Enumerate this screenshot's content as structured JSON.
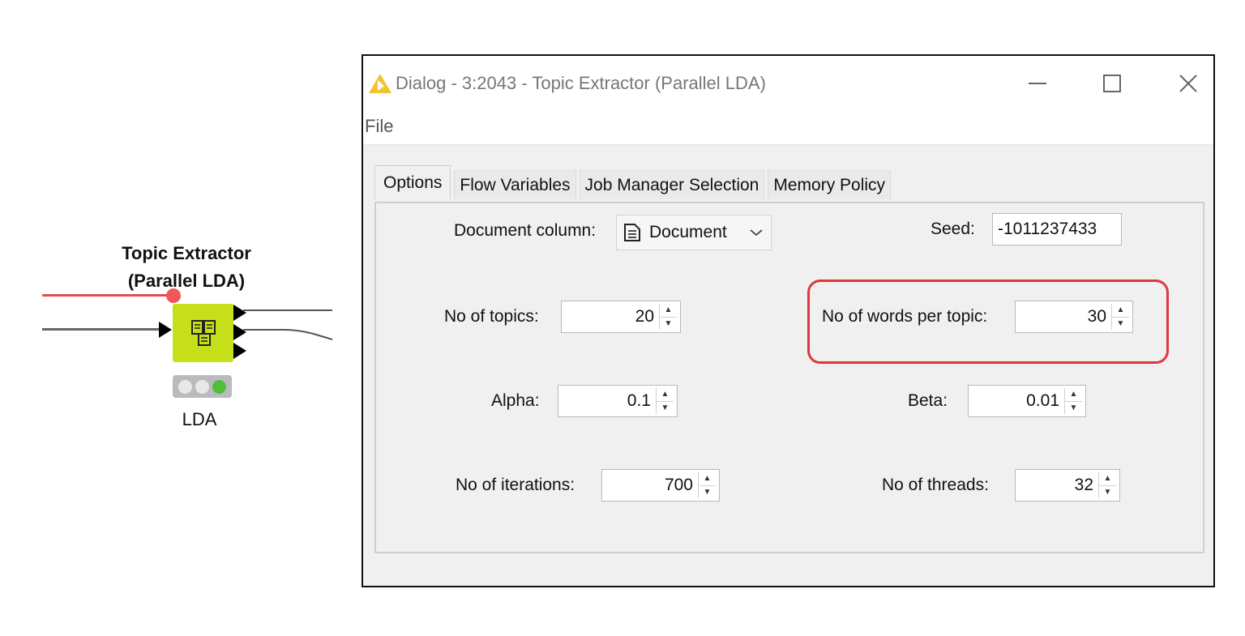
{
  "node": {
    "title_line1": "Topic Extractor",
    "title_line2": "(Parallel LDA)",
    "label": "LDA",
    "status": "executed"
  },
  "dialog": {
    "title": "Dialog - 3:2043 - Topic Extractor (Parallel LDA)",
    "menu": {
      "file": "File"
    },
    "tabs": [
      {
        "label": "Options",
        "active": true
      },
      {
        "label": "Flow Variables",
        "active": false
      },
      {
        "label": "Job Manager Selection",
        "active": false
      },
      {
        "label": "Memory Policy",
        "active": false
      }
    ],
    "options": {
      "document_column": {
        "label": "Document column:",
        "value": "Document"
      },
      "seed": {
        "label": "Seed:",
        "value": "-1011237433"
      },
      "topics": {
        "label": "No of topics:",
        "value": "20"
      },
      "words_per_topic": {
        "label": "No of words per topic:",
        "value": "30"
      },
      "alpha": {
        "label": "Alpha:",
        "value": "0.1"
      },
      "beta": {
        "label": "Beta:",
        "value": "0.01"
      },
      "iterations": {
        "label": "No of iterations:",
        "value": "700"
      },
      "threads": {
        "label": "No of threads:",
        "value": "32"
      }
    }
  },
  "colors": {
    "node_body": "#c5df1a",
    "highlight": "#e0373c",
    "connection_active": "#e8494a"
  }
}
